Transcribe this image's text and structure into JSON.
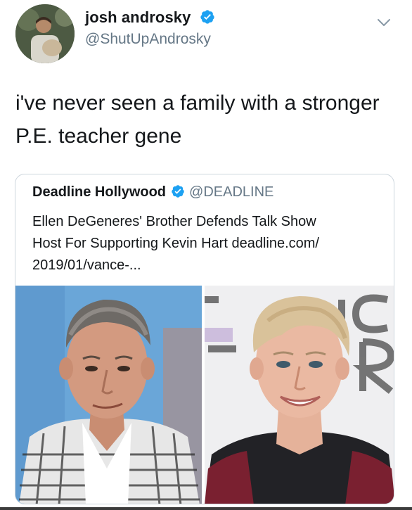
{
  "author": {
    "display_name": "josh androsky",
    "handle": "@ShutUpAndrosky",
    "verified_icon": "verified-badge-icon",
    "avatar": "avatar"
  },
  "tweet": {
    "text_line1": "i've never seen a family with a stronger",
    "text_line2": "P.E. teacher gene"
  },
  "menu": {
    "icon": "chevron-down-icon"
  },
  "quoted": {
    "display_name": "Deadline Hollywood",
    "handle": "@DEADLINE",
    "body_line1": "Ellen DeGeneres' Brother Defends Talk Show",
    "body_line2": "Host For Supporting Kevin Hart deadline.com/",
    "body_line3": "2019/01/vance-...",
    "photos": [
      "man-portrait-photo",
      "woman-portrait-photo"
    ]
  },
  "colors": {
    "verified_blue": "#1da1f2",
    "secondary_text": "#657786",
    "primary_text": "#14171a",
    "card_border": "#cdd6dd"
  }
}
